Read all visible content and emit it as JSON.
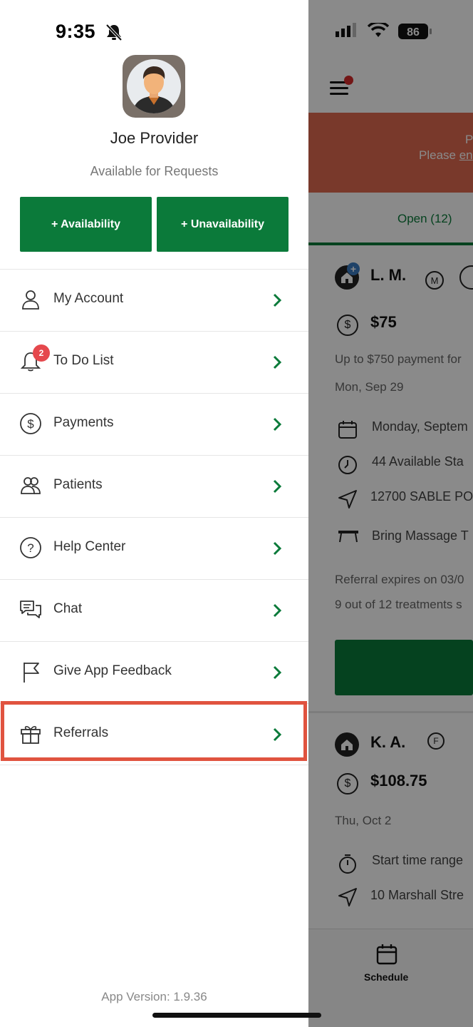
{
  "status_bar": {
    "time": "9:35",
    "battery": "86"
  },
  "profile": {
    "name": "Joe Provider",
    "status": "Available for Requests"
  },
  "actions": {
    "availability": "+ Availability",
    "unavailability": "+ Unavailability"
  },
  "menu": {
    "items": [
      {
        "label": "My Account",
        "icon": "user-icon"
      },
      {
        "label": "To Do List",
        "icon": "bell-icon",
        "badge": "2"
      },
      {
        "label": "Payments",
        "icon": "dollar-circle-icon"
      },
      {
        "label": "Patients",
        "icon": "users-icon"
      },
      {
        "label": "Help Center",
        "icon": "question-circle-icon"
      },
      {
        "label": "Chat",
        "icon": "chat-bubbles-icon"
      },
      {
        "label": "Give App Feedback",
        "icon": "flag-icon"
      },
      {
        "label": "Referrals",
        "icon": "gift-icon"
      }
    ]
  },
  "app_version": "App Version: 1.9.36",
  "background": {
    "banner_line1": "P",
    "banner_line2_prefix": "Please ",
    "banner_line2_link": "en",
    "tab_open": "Open (12)",
    "card1": {
      "name": "L. M.",
      "gender_symbol": "M",
      "price": "$75",
      "note": "Up to $750 payment for",
      "date": "Mon, Sep 29",
      "detail1": "Monday, Septem",
      "detail2": "44 Available Sta",
      "detail3": "12700 SABLE PO",
      "detail4": "Bring Massage T",
      "expires": "Referral expires on 03/0",
      "treatments": "9 out of 12 treatments s"
    },
    "card2": {
      "name": "K. A.",
      "gender_symbol": "F",
      "price": "$108.75",
      "date": "Thu, Oct 2",
      "detail1": "Start time range",
      "detail2": "10 Marshall Stre"
    },
    "bottom_tab": "Schedule"
  },
  "colors": {
    "brand_green": "#0b7a3a",
    "highlight_red": "#e0533f",
    "badge_red": "#e5484d"
  }
}
